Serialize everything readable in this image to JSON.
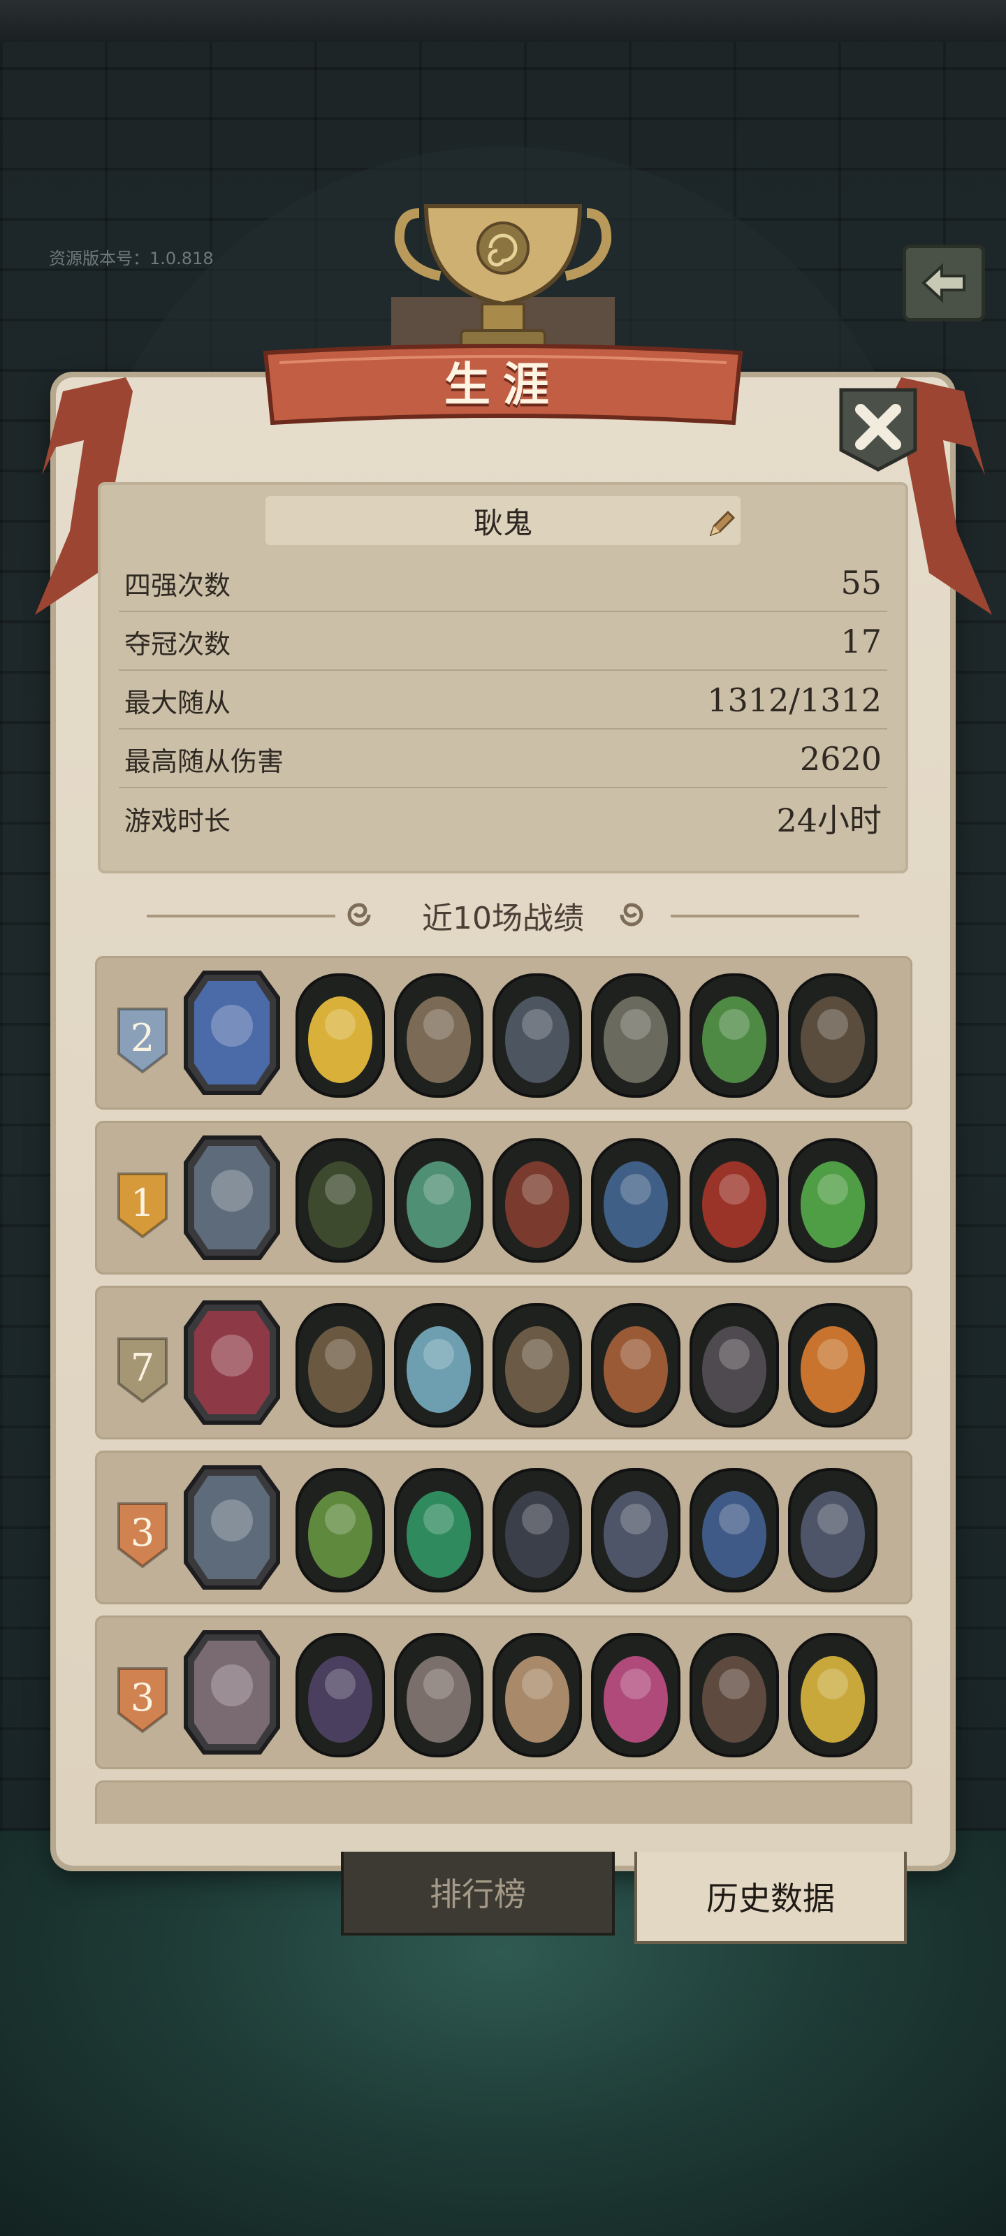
{
  "version_label": "资源版本号：1.0.818",
  "title": "生涯",
  "profile": {
    "name": "耿鬼"
  },
  "stats": [
    {
      "label": "四强次数",
      "value": "55"
    },
    {
      "label": "夺冠次数",
      "value": "17"
    },
    {
      "label": "最大随从",
      "value": "1312/1312"
    },
    {
      "label": "最高随从伤害",
      "value": "2620"
    },
    {
      "label": "游戏时长",
      "value": "24小时"
    }
  ],
  "recent_title": "近10场战绩",
  "matches": [
    {
      "rank": "2",
      "badge": "silver",
      "hero_color": "#4b6aa8",
      "minions": [
        "#d9b13a",
        "#7b6a55",
        "#4d5560",
        "#6b6a5e",
        "#4f8a45",
        "#5b4d3e"
      ]
    },
    {
      "rank": "1",
      "badge": "gold",
      "hero_color": "#5e6b7a",
      "minions": [
        "#3e4a2e",
        "#4f8f74",
        "#7a3b2e",
        "#3f5f86",
        "#9a3328",
        "#4f9e45"
      ]
    },
    {
      "rank": "7",
      "badge": "stone",
      "hero_color": "#8e3a46",
      "minions": [
        "#6b5840",
        "#6d9fb0",
        "#6b5a45",
        "#9a5a36",
        "#4f4a4f",
        "#c8742e"
      ]
    },
    {
      "rank": "3",
      "badge": "bronze",
      "hero_color": "#5e6b7a",
      "minions": [
        "#5f8a3e",
        "#2f8a5e",
        "#3b3f4a",
        "#4f5568",
        "#3f5a86",
        "#4f5568"
      ]
    },
    {
      "rank": "3",
      "badge": "bronze",
      "hero_color": "#7a6a72",
      "minions": [
        "#4a3f5e",
        "#7a6f6a",
        "#a88a6a",
        "#b04a7a",
        "#5e4a3e",
        "#c8a83a"
      ]
    }
  ],
  "tabs": {
    "ranking": "排行榜",
    "history": "历史数据"
  },
  "colors": {
    "banner": "#c25e44",
    "panel": "#e3d9c7",
    "badge_silver": "#8aa0b8",
    "badge_gold": "#d79a3a",
    "badge_stone": "#a59674",
    "badge_bronze": "#d08250"
  }
}
